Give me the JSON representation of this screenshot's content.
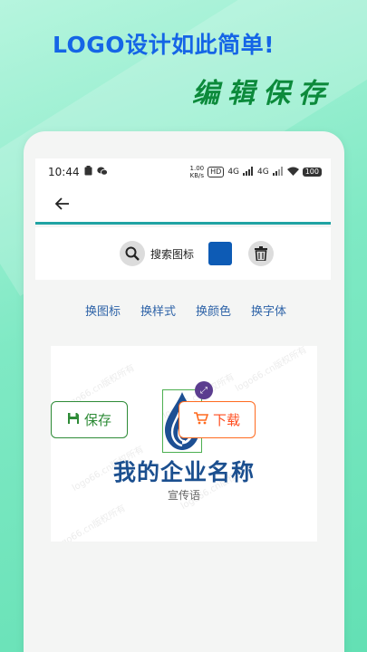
{
  "promo": {
    "headline": "LOGO设计如此简单!",
    "subline": "编辑保存"
  },
  "status_bar": {
    "time": "10:44",
    "speed": "1.00",
    "speed_unit": "KB/s",
    "hd": "HD",
    "net1": "4G",
    "net2": "4G",
    "battery": "100"
  },
  "toolbar": {
    "back_icon": "back-arrow-icon"
  },
  "tools": {
    "search_label": "搜索图标",
    "swatch_color": "#0d5bb5"
  },
  "tabs": [
    {
      "label": "换图标"
    },
    {
      "label": "换样式"
    },
    {
      "label": "换颜色"
    },
    {
      "label": "换字体"
    }
  ],
  "logo": {
    "company_name": "我的企业名称",
    "slogan": "宣传语",
    "watermark": "logo66.cn版权所有"
  },
  "actions": {
    "save_label": "保存",
    "download_label": "下载"
  }
}
